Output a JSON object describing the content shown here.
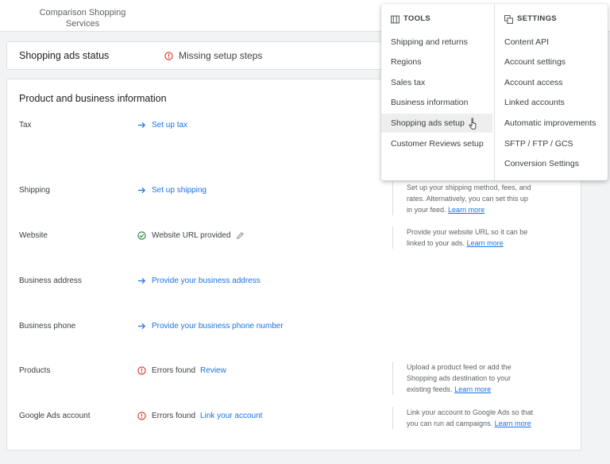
{
  "brand": {
    "name": "Comparison Shopping Services"
  },
  "status": {
    "title": "Shopping ads status",
    "text": "Missing setup steps",
    "icon": "error-circle-icon"
  },
  "section": {
    "title": "Product and business information"
  },
  "rows": [
    {
      "label": "Tax",
      "action": "Set up tax",
      "icon": "arrow-right-icon",
      "help": ""
    },
    {
      "label": "Shipping",
      "action": "Set up shipping",
      "icon": "arrow-right-icon",
      "help": "Set up your shipping method, fees, and rates. Alternatively, you can set this up in your feed.",
      "help_link": "Learn more"
    },
    {
      "label": "Website",
      "action": "Website URL provided",
      "icon": "check-circle-icon",
      "help": "Provide your website URL so it can be linked to your ads.",
      "help_link": "Learn more"
    },
    {
      "label": "Business address",
      "action": "Provide your business address",
      "icon": "arrow-right-icon",
      "help": ""
    },
    {
      "label": "Business phone",
      "action": "Provide your business phone number",
      "icon": "arrow-right-icon",
      "help": ""
    },
    {
      "label": "Products",
      "status": "Errors found",
      "action": "Review",
      "icon": "error-circle-icon",
      "help": "Upload a product feed or add the Shopping ads destination to your existing feeds.",
      "help_link": "Learn more"
    },
    {
      "label": "Google Ads account",
      "status": "Errors found",
      "action": "Link your account",
      "icon": "error-circle-icon",
      "help": "Link your account to Google Ads so that you can run ad campaigns.",
      "help_link": "Learn more"
    }
  ],
  "menu": {
    "tools": {
      "heading": "TOOLS",
      "items": [
        "Shipping and returns",
        "Regions",
        "Sales tax",
        "Business information",
        "Shopping ads setup",
        "Customer Reviews setup"
      ],
      "active_index": 4
    },
    "settings": {
      "heading": "SETTINGS",
      "items": [
        "Content API",
        "Account settings",
        "Account access",
        "Linked accounts",
        "Automatic improvements",
        "SFTP / FTP / GCS",
        "Conversion Settings"
      ]
    }
  },
  "colors": {
    "link": "#1a73e8",
    "error": "#d93025",
    "success": "#188038"
  }
}
